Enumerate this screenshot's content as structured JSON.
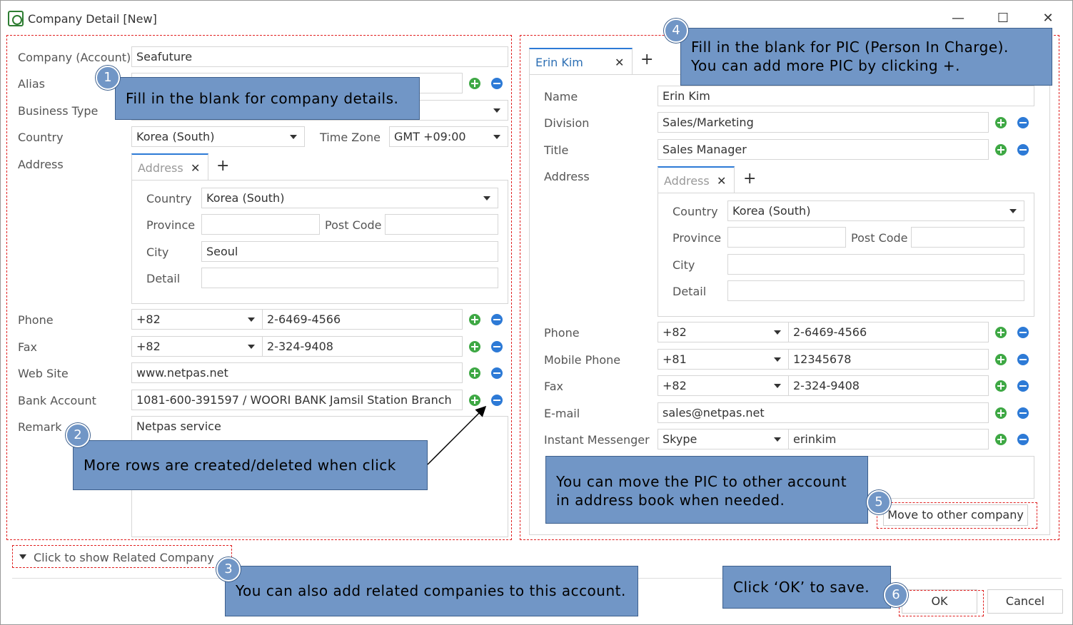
{
  "window": {
    "title": "Company Detail [New]",
    "minimize": "—",
    "maximize": "☐",
    "close": "✕"
  },
  "company": {
    "labels": {
      "account": "Company (Account)",
      "alias": "Alias",
      "business_type": "Business Type",
      "country": "Country",
      "time_zone": "Time Zone",
      "address": "Address",
      "phone": "Phone",
      "fax": "Fax",
      "web_site": "Web Site",
      "bank_account": "Bank Account",
      "remark": "Remark"
    },
    "values": {
      "account": "Seafuture",
      "country": "Korea (South)",
      "time_zone": "GMT +09:00",
      "phone_code": "+82",
      "phone": "2-6469-4566",
      "fax_code": "+82",
      "fax": "2-324-9408",
      "web_site": "www.netpas.net",
      "bank_account": "1081-600-391597 / WOORI BANK Jamsil Station Branch",
      "remark": "Netpas service"
    },
    "address_tab": {
      "tab_label": "Address",
      "close": "✕",
      "add": "+",
      "labels": {
        "country": "Country",
        "province": "Province",
        "post_code": "Post Code",
        "city": "City",
        "detail": "Detail"
      },
      "values": {
        "country": "Korea (South)",
        "city": "Seoul"
      }
    }
  },
  "pic": {
    "tab_label": "Erin Kim",
    "tab_close": "✕",
    "tab_add": "+",
    "labels": {
      "name": "Name",
      "division": "Division",
      "title": "Title",
      "address": "Address",
      "phone": "Phone",
      "mobile": "Mobile Phone",
      "fax": "Fax",
      "email": "E-mail",
      "im": "Instant Messenger"
    },
    "values": {
      "name": "Erin Kim",
      "division": "Sales/Marketing",
      "title": "Sales Manager",
      "phone_code": "+82",
      "phone": "2-6469-4566",
      "mobile_code": "+81",
      "mobile": "12345678",
      "fax_code": "+82",
      "fax": "2-324-9408",
      "email": "sales@netpas.net",
      "im_type": "Skype",
      "im": "erinkim"
    },
    "address_tab": {
      "tab_label": "Address",
      "close": "✕",
      "add": "+",
      "labels": {
        "country": "Country",
        "province": "Province",
        "post_code": "Post Code",
        "city": "City",
        "detail": "Detail"
      },
      "values": {
        "country": "Korea (South)"
      }
    },
    "move_button": "Move to other company"
  },
  "related": {
    "label": "Click to show Related Company"
  },
  "footer": {
    "ok": "OK",
    "cancel": "Cancel"
  },
  "callouts": {
    "c1": "Fill in the blank for company details.",
    "c2": "More rows are created/deleted when click",
    "c3": "You can also add related companies to this account.",
    "c4_line1": "Fill in the blank for PIC (Person In Charge).",
    "c4_line2": "You can add more PIC by clicking +.",
    "c5_line1": "You can move the PIC to other account",
    "c5_line2": "in address book when needed.",
    "c6": "Click ‘OK’ to save."
  },
  "badges": {
    "b1": "1",
    "b2": "2",
    "b3": "3",
    "b4": "4",
    "b5": "5",
    "b6": "6"
  },
  "colors": {
    "callout": "#7196c6",
    "dashed": "#e02020",
    "plus": "#3ea844",
    "minus": "#2d7ad6",
    "tab_active": "#2d6fb4"
  }
}
